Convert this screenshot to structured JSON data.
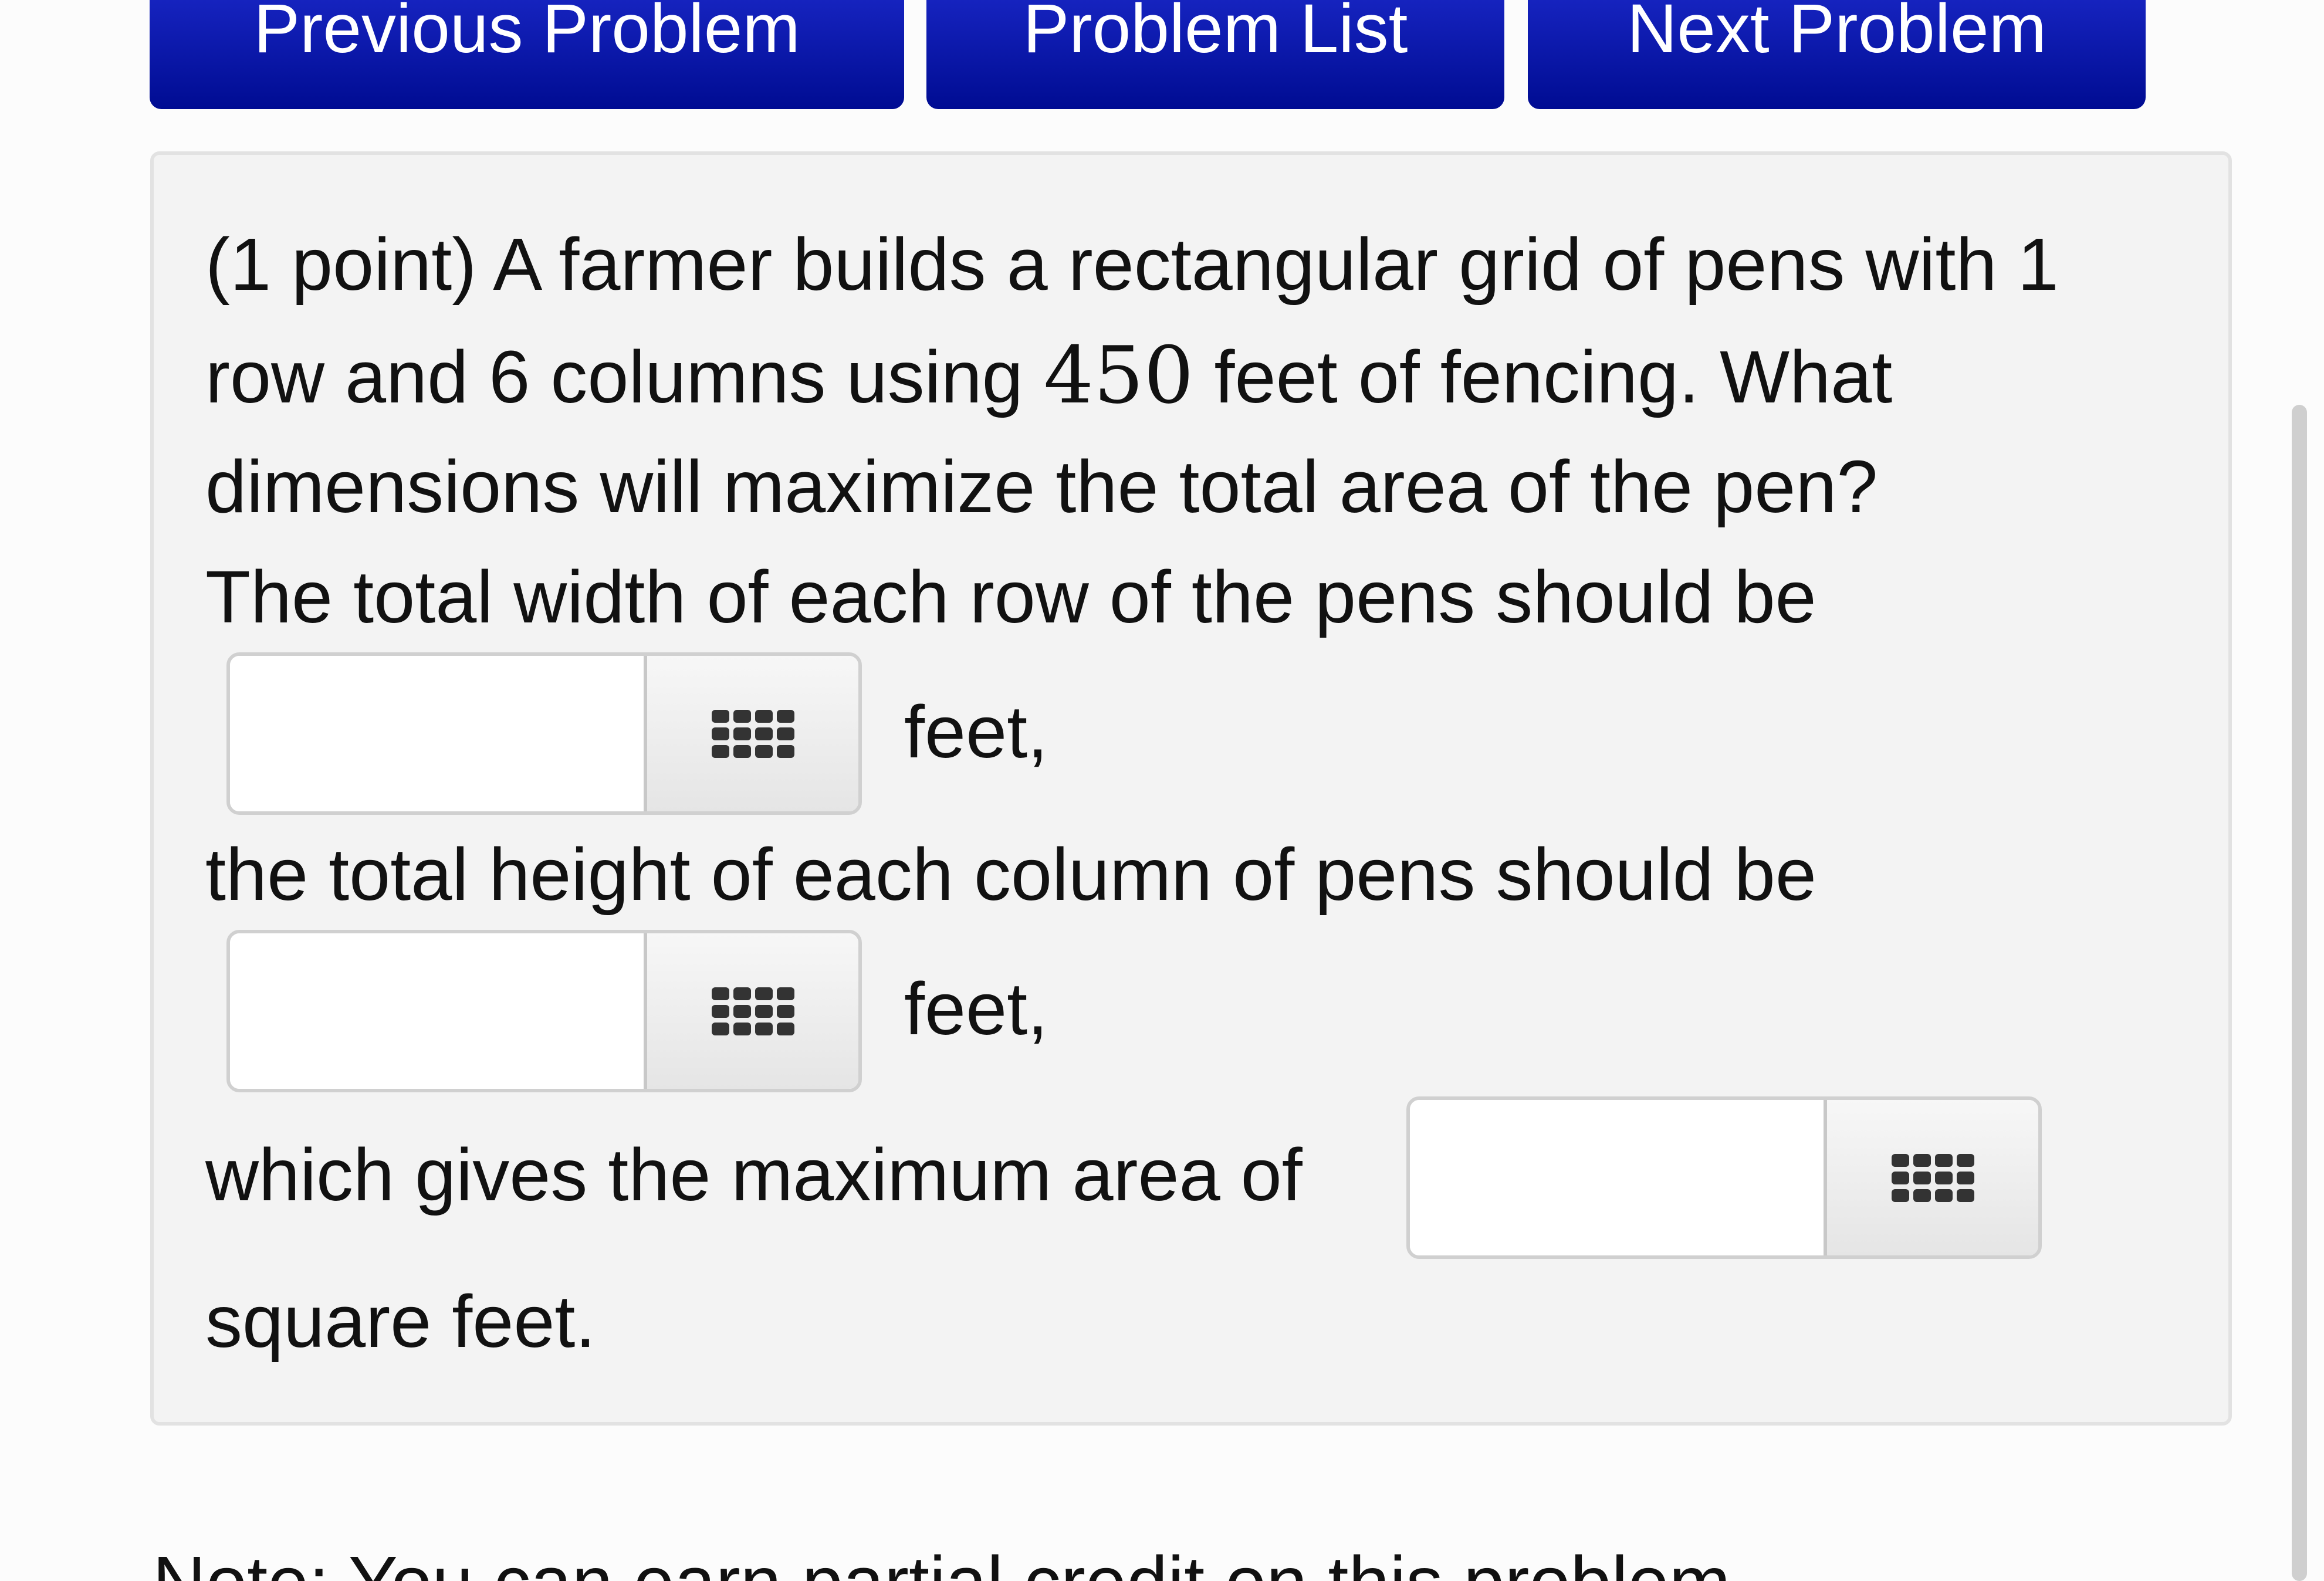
{
  "nav": {
    "previous_label": "Previous Problem",
    "list_label": "Problem List",
    "next_label": "Next Problem"
  },
  "problem": {
    "line1": "(1 point) A farmer builds a rectangular grid of pens with 1",
    "line2_prefix": "row and 6 columns using ",
    "fencing_total": "450",
    "line2_suffix": " feet of fencing. What",
    "line3": "dimensions will maximize the total area of the pen?",
    "line4": "The total width of each row of the pens should be",
    "width_unit": "feet,",
    "line5": "the total height of each column of pens should be",
    "height_unit": "feet,",
    "line6": "which gives the maximum area of",
    "line7": "square feet."
  },
  "answers": {
    "width_value": "",
    "height_value": "",
    "area_value": "",
    "palette_icon": "grid-keypad-icon"
  },
  "note_partial": "Note: You can earn partial credit on this problem."
}
